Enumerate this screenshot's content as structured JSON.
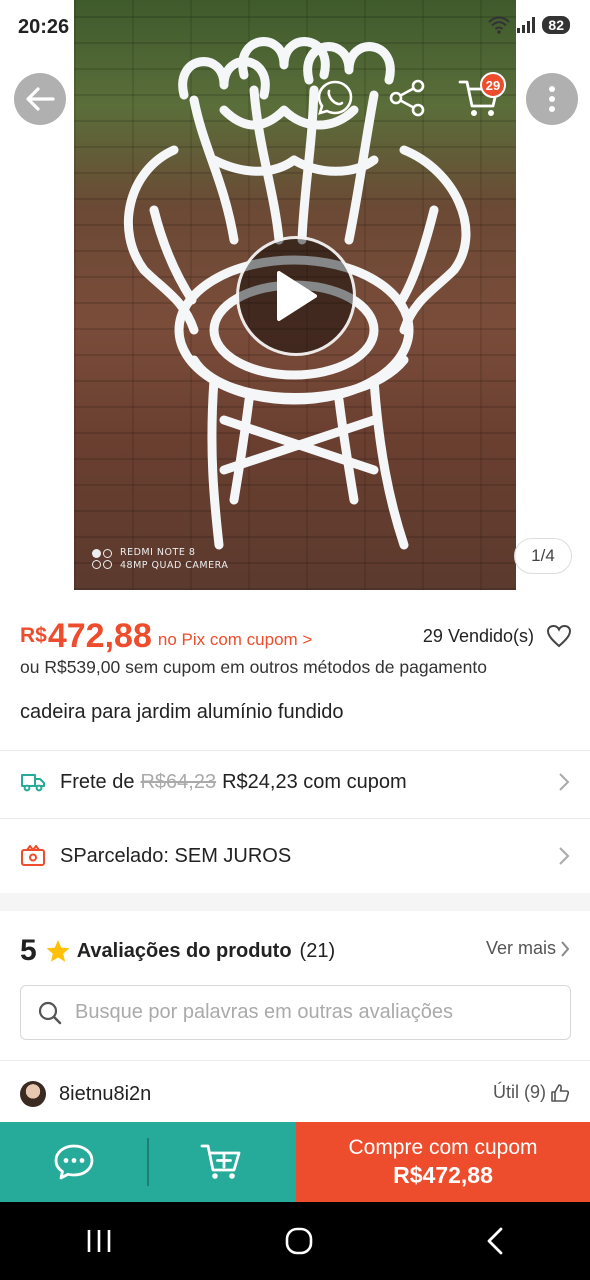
{
  "status_bar": {
    "time": "20:26",
    "battery": "82"
  },
  "gallery": {
    "camera_line1": "REDMI NOTE 8",
    "camera_line2": "48MP QUAD CAMERA",
    "counter": "1/4",
    "cart_count": "29"
  },
  "product": {
    "currency": "R$",
    "price": "472,88",
    "price_note": "no Pix com cupom >",
    "sold": "29 Vendido(s)",
    "alt_price": "ou R$539,00 sem cupom em outros métodos de pagamento",
    "title": "cadeira para jardim alumínio fundido"
  },
  "shipping": {
    "label": "Frete de",
    "old_price": "R$64,23",
    "new_price": "R$24,23 com cupom"
  },
  "installments": {
    "label": "SParcelado: SEM JUROS"
  },
  "reviews": {
    "rating": "5",
    "label": "Avaliações do produto",
    "count": "(21)",
    "see_more": "Ver mais",
    "search_placeholder": "Busque por palavras em outras avaliações",
    "first_reviewer": "8ietnu8i2n",
    "useful": "Útil (9)"
  },
  "bottom_bar": {
    "buy_line1": "Compre com cupom",
    "buy_line2": "R$472,88"
  },
  "colors": {
    "accent": "#ee4d2d",
    "teal": "#26aa99"
  }
}
